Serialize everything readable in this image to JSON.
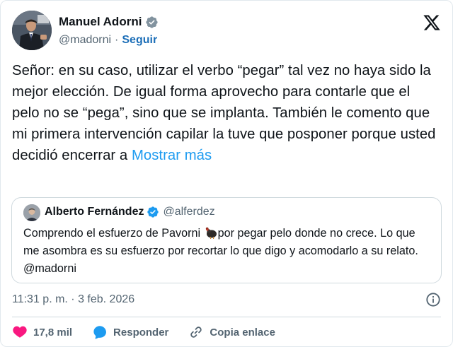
{
  "author": {
    "name": "Manuel Adorni",
    "handle": "@madorni",
    "separator": "·",
    "follow_label": "Seguir"
  },
  "tweet": {
    "text": "Señor: en su caso, utilizar el verbo “pegar” tal vez no haya sido la mejor elección. De igual forma aprovecho para contarle que el pelo no se “pega”, sino que se implanta. También le comento que mi primera intervención capilar la tuve que posponer porque usted decidió encerrar a",
    "show_more_label": "Mostrar más"
  },
  "quoted": {
    "name": "Alberto Fernández",
    "handle": "@alferdez",
    "text_before": "Comprendo el esfuerzo de Pavorni ",
    "text_after": "por pegar pelo donde no crece. Lo que me asombra es su esfuerzo por recortar lo que digo y acomodarlo a su relato. @madorni",
    "emoji_icon": "turkey-icon"
  },
  "timestamp": "11:31 p. m. · 3 feb. 2026",
  "actions": {
    "likes_count": "17,8 mil",
    "reply_label": "Responder",
    "copy_link_label": "Copia enlace"
  },
  "colors": {
    "link": "#1d9bf0",
    "follow": "#1d6fb8",
    "like": "#f91880",
    "secondary_text": "#536471",
    "verified": "#1d9bf0"
  },
  "icons": [
    "verified-badge-icon",
    "x-logo-icon",
    "info-icon",
    "heart-icon",
    "reply-bubble-icon",
    "link-icon"
  ]
}
